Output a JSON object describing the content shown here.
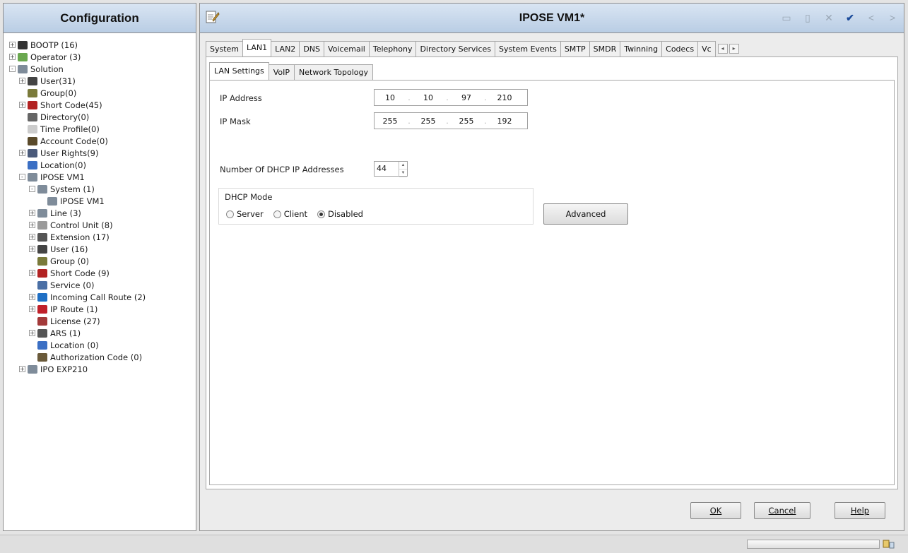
{
  "left_pane": {
    "title": "Configuration",
    "tree": [
      {
        "label": "BOOTP (16)",
        "expander": "+",
        "icon": "bootp-icon",
        "color": "#333333",
        "indent": 0
      },
      {
        "label": "Operator (3)",
        "expander": "+",
        "icon": "operator-icon",
        "color": "#6aa84f",
        "indent": 0
      },
      {
        "label": "Solution",
        "expander": "-",
        "icon": "solution-icon",
        "color": "#7f8c9a",
        "indent": 0
      },
      {
        "label": "User(31)",
        "expander": "+",
        "icon": "user-icon",
        "color": "#444444",
        "indent": 1
      },
      {
        "label": "Group(0)",
        "expander": "",
        "icon": "group-icon",
        "color": "#7a7a3a",
        "indent": 1
      },
      {
        "label": "Short Code(45)",
        "expander": "+",
        "icon": "short-code-icon",
        "color": "#b22222",
        "indent": 1
      },
      {
        "label": "Directory(0)",
        "expander": "",
        "icon": "directory-icon",
        "color": "#666666",
        "indent": 1
      },
      {
        "label": "Time Profile(0)",
        "expander": "",
        "icon": "time-profile-icon",
        "color": "#cccccc",
        "indent": 1
      },
      {
        "label": "Account Code(0)",
        "expander": "",
        "icon": "account-code-icon",
        "color": "#5a4a2a",
        "indent": 1
      },
      {
        "label": "User Rights(9)",
        "expander": "+",
        "icon": "user-rights-icon",
        "color": "#4a5a7a",
        "indent": 1
      },
      {
        "label": "Location(0)",
        "expander": "",
        "icon": "location-icon",
        "color": "#3b6fc4",
        "indent": 1
      },
      {
        "label": "IPOSE VM1",
        "expander": "-",
        "icon": "system-node-icon",
        "color": "#7f8c9a",
        "indent": 1
      },
      {
        "label": "System (1)",
        "expander": "-",
        "icon": "system-icon",
        "color": "#7f8c9a",
        "indent": 2
      },
      {
        "label": "IPOSE VM1",
        "expander": "",
        "icon": "system-node-icon",
        "color": "#7f8c9a",
        "indent": 3
      },
      {
        "label": "Line (3)",
        "expander": "+",
        "icon": "line-icon",
        "color": "#7f8c9a",
        "indent": 2
      },
      {
        "label": "Control Unit (8)",
        "expander": "+",
        "icon": "control-unit-icon",
        "color": "#9a9a9a",
        "indent": 2
      },
      {
        "label": "Extension (17)",
        "expander": "+",
        "icon": "extension-icon",
        "color": "#555555",
        "indent": 2
      },
      {
        "label": "User (16)",
        "expander": "+",
        "icon": "user-icon",
        "color": "#444444",
        "indent": 2
      },
      {
        "label": "Group (0)",
        "expander": "",
        "icon": "group-icon",
        "color": "#7a7a3a",
        "indent": 2
      },
      {
        "label": "Short Code (9)",
        "expander": "+",
        "icon": "short-code-icon",
        "color": "#b22222",
        "indent": 2
      },
      {
        "label": "Service (0)",
        "expander": "",
        "icon": "service-icon",
        "color": "#4a6fa5",
        "indent": 2
      },
      {
        "label": "Incoming Call Route (2)",
        "expander": "+",
        "icon": "incoming-call-route-icon",
        "color": "#1f6fc4",
        "indent": 2
      },
      {
        "label": "IP Route (1)",
        "expander": "+",
        "icon": "ip-route-icon",
        "color": "#c0202a",
        "indent": 2
      },
      {
        "label": "License (27)",
        "expander": "",
        "icon": "license-icon",
        "color": "#a33a3a",
        "indent": 2
      },
      {
        "label": "ARS (1)",
        "expander": "+",
        "icon": "ars-icon",
        "color": "#555555",
        "indent": 2
      },
      {
        "label": "Location (0)",
        "expander": "",
        "icon": "location-icon",
        "color": "#3b6fc4",
        "indent": 2
      },
      {
        "label": "Authorization Code (0)",
        "expander": "",
        "icon": "authorization-code-icon",
        "color": "#6a5a3a",
        "indent": 2
      },
      {
        "label": "IPO EXP210",
        "expander": "+",
        "icon": "system-node-icon",
        "color": "#7f8c9a",
        "indent": 1
      }
    ]
  },
  "right_pane": {
    "title": "IPOSE VM1*",
    "toolbar": {
      "check_icon": "✔",
      "prev_icon": "<",
      "next_icon": ">",
      "close_icon": "✕"
    },
    "tabs": [
      "System",
      "LAN1",
      "LAN2",
      "DNS",
      "Voicemail",
      "Telephony",
      "Directory Services",
      "System Events",
      "SMTP",
      "SMDR",
      "Twinning",
      "Codecs",
      "Vc"
    ],
    "active_tab": "LAN1",
    "subtabs": [
      "LAN Settings",
      "VoIP",
      "Network Topology"
    ],
    "active_subtab": "LAN Settings",
    "lan_settings": {
      "ip_address_label": "IP Address",
      "ip_address": [
        "10",
        "10",
        "97",
        "210"
      ],
      "ip_mask_label": "IP Mask",
      "ip_mask": [
        "255",
        "255",
        "255",
        "192"
      ],
      "dhcp_count_label": "Number Of DHCP IP Addresses",
      "dhcp_count": "44",
      "dhcp_mode_label": "DHCP Mode",
      "dhcp_modes": [
        "Server",
        "Client",
        "Disabled"
      ],
      "dhcp_mode_selected": "Disabled",
      "advanced_label": "Advanced"
    },
    "buttons": {
      "ok": "OK",
      "cancel": "Cancel",
      "help": "Help"
    }
  }
}
